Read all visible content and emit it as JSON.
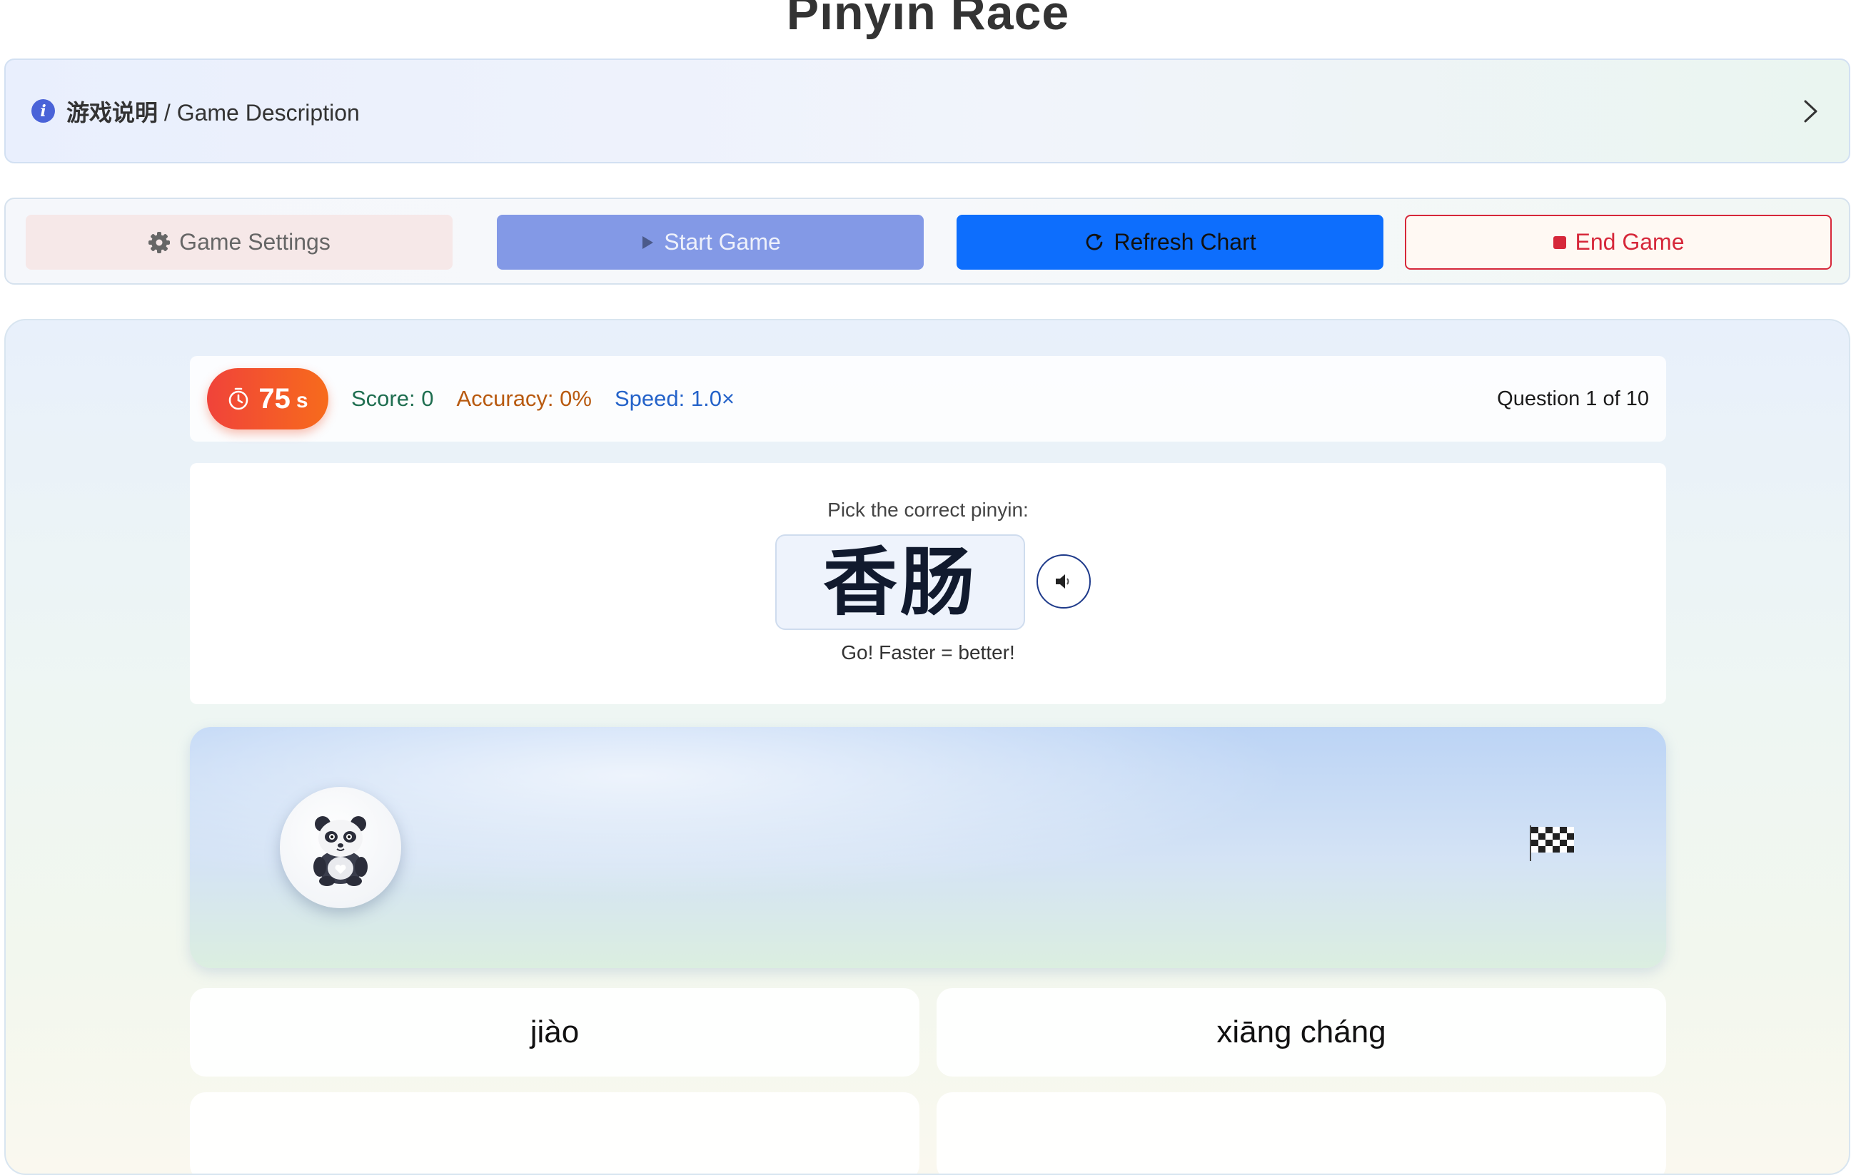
{
  "page": {
    "title": "Pinyin Race"
  },
  "description": {
    "label_zh": "游戏说明",
    "label_sep": " / ",
    "label_en": "Game Description"
  },
  "controls": {
    "settings_label": "Game Settings",
    "start_label": "Start Game",
    "refresh_label": "Refresh Chart",
    "end_label": "End Game"
  },
  "stats": {
    "timer_value": "75",
    "timer_unit": "s",
    "score": "Score: 0",
    "accuracy": "Accuracy: 0%",
    "speed": "Speed: 1.0×",
    "question_count": "Question 1 of 10"
  },
  "question": {
    "prompt": "Pick the correct pinyin:",
    "character": "香肠",
    "hint": "Go! Faster = better!"
  },
  "answers": [
    {
      "text": "jiào"
    },
    {
      "text": "xiāng cháng"
    },
    {
      "text": ""
    },
    {
      "text": ""
    }
  ],
  "colors": {
    "primary": "#0d6efd",
    "start_disabled": "#8399e6",
    "danger": "#d6283a",
    "timer_start": "#f0433a",
    "timer_end": "#f76b1c",
    "info": "#4a63d8"
  },
  "icons": {
    "description": "info-icon",
    "expand": "chevron-right-icon",
    "settings": "gear-icon",
    "start": "play-icon",
    "refresh": "refresh-icon",
    "end": "stop-icon",
    "timer": "stopwatch-icon",
    "audio": "speaker-icon",
    "player": "panda-icon",
    "finish": "checkered-flag-icon"
  }
}
